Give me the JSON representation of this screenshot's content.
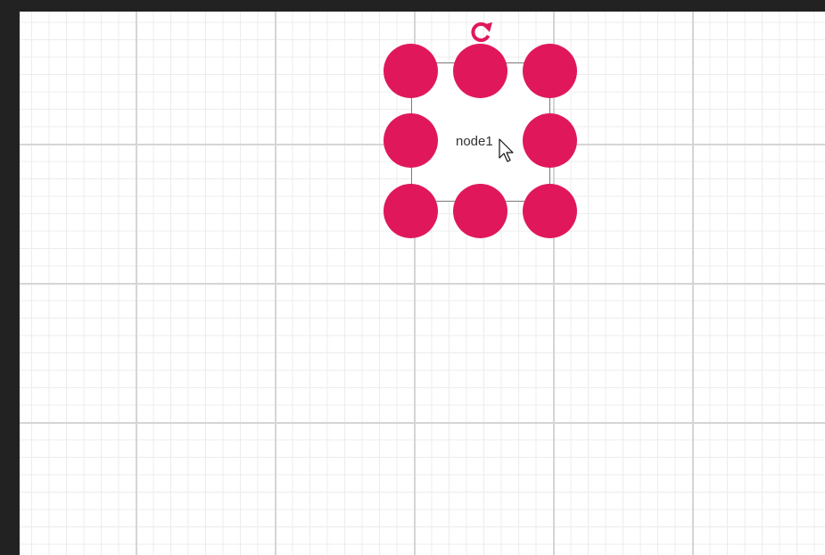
{
  "diagram": {
    "node": {
      "label": "node1"
    },
    "handles": [
      "top-left",
      "top-center",
      "top-right",
      "middle-left",
      "middle-right",
      "bottom-left",
      "bottom-center",
      "bottom-right"
    ],
    "rotate_icon": "rotate-icon",
    "cursor_icon": "mouse-pointer-icon"
  },
  "colors": {
    "handle": "#e0185b",
    "grid_major": "#d5d5d5",
    "grid_minor": "#ececec",
    "frame": "#222222"
  }
}
